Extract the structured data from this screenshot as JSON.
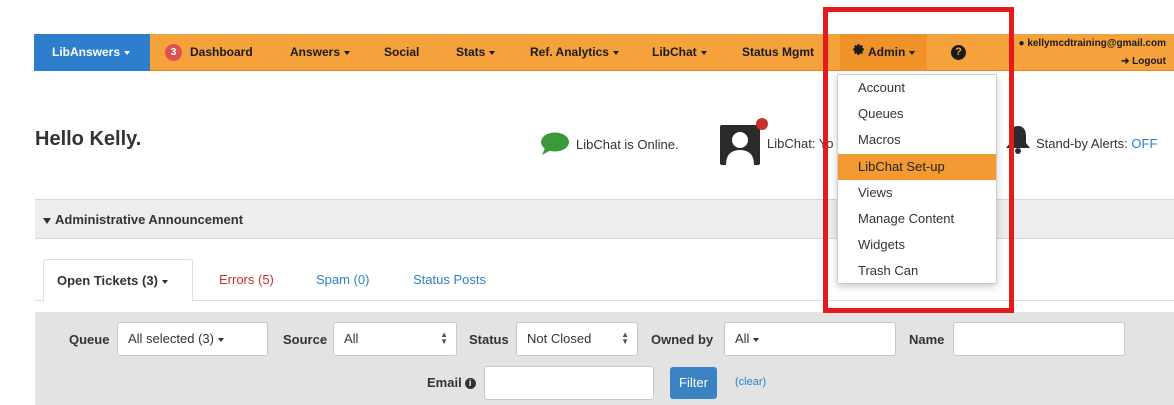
{
  "colors": {
    "topbar": "#f6a23c",
    "brand_blue": "#2d7fce",
    "badge_red": "#d9534f",
    "active_menu": "#f39a32",
    "highlight": "#e31b1b"
  },
  "nav": {
    "brand": "LibAnswers",
    "dashboard_badge": "3",
    "items": [
      "Dashboard",
      "Answers",
      "Social",
      "Stats",
      "Ref. Analytics",
      "LibChat",
      "Status Mgmt"
    ],
    "admin": "Admin",
    "help_icon": "question-circle-icon",
    "user_email": "kellymcdtraining@gmail.com",
    "logout": "Logout"
  },
  "header": {
    "greeting": "Hello Kelly.",
    "libchat_online": "LibChat is Online.",
    "libchat_status": "LibChat: Yo",
    "standby_label": "Stand-by Alerts:",
    "standby_value": "OFF"
  },
  "announcement": {
    "label": "Administrative Announcement"
  },
  "tabs": [
    "Open Tickets (3)",
    "Errors (5)",
    "Spam (0)",
    "Status Posts"
  ],
  "filters": {
    "queue_label": "Queue",
    "queue_value": "All selected (3)",
    "source_label": "Source",
    "source_value": "All",
    "status_label": "Status",
    "status_value": "Not Closed",
    "owned_label": "Owned by",
    "owned_value": "All",
    "name_label": "Name",
    "email_label": "Email",
    "filter_button": "Filter",
    "clear_link": "(clear)"
  },
  "admin_menu": {
    "items": [
      "Account",
      "Queues",
      "Macros",
      "LibChat Set-up",
      "Views",
      "Manage Content",
      "Widgets",
      "Trash Can"
    ],
    "active_item": "LibChat Set-up"
  }
}
